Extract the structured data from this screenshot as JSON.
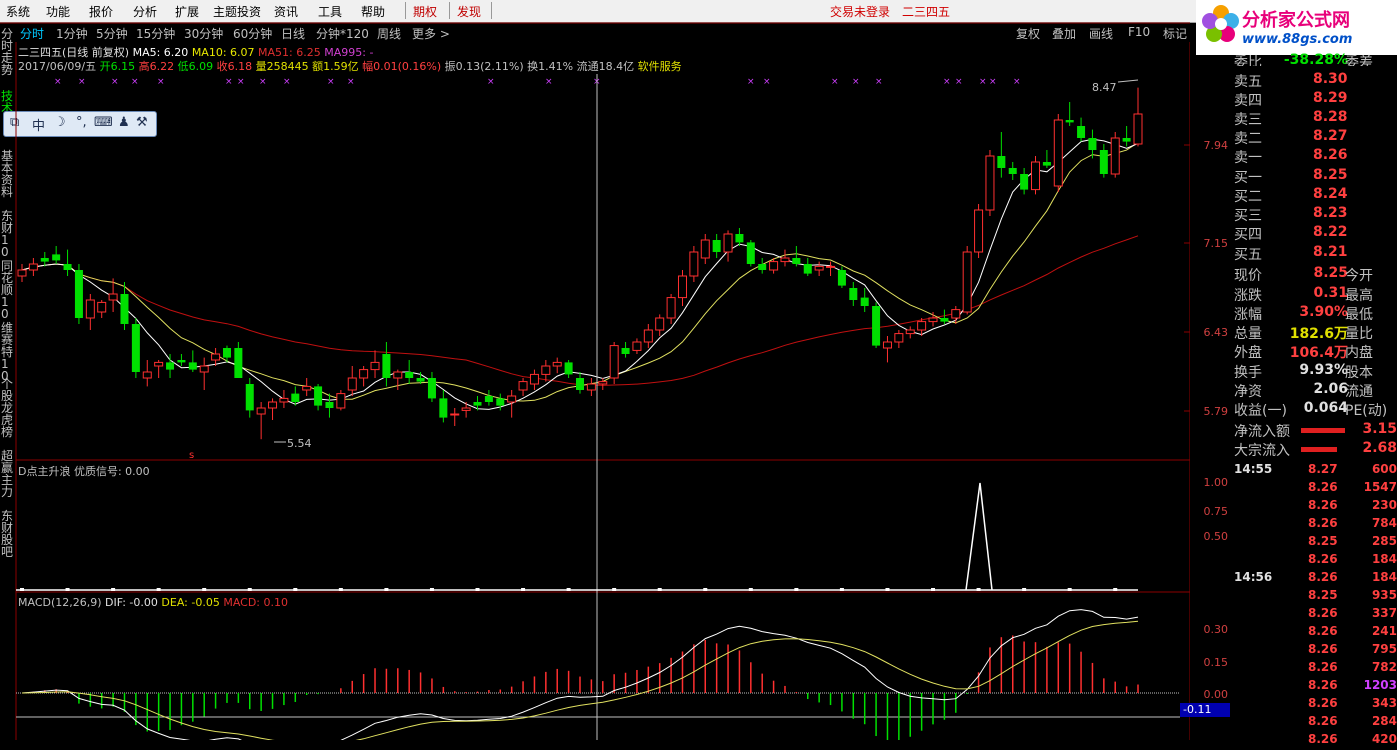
{
  "menu": {
    "items": [
      "系统",
      "功能",
      "报价",
      "分析",
      "扩展",
      "主题投资",
      "资讯",
      "工具",
      "帮助"
    ],
    "red_items": [
      "期权",
      "发现"
    ],
    "status": "交易未登录",
    "stock": "二三四五"
  },
  "logo": {
    "title": "分析家公式网",
    "url": "www.88gs.com"
  },
  "periods": [
    "分时",
    "1分钟",
    "5分钟",
    "15分钟",
    "30分钟",
    "60分钟",
    "日线",
    "分钟*120",
    "周线",
    "更多 >"
  ],
  "active_period": "分时",
  "tools_right": [
    "复权",
    "叠加",
    "画线",
    "F10",
    "标记"
  ],
  "side_tabs": [
    "分时走势",
    "技术分析",
    "基本资料",
    "东财10",
    "同花顺10",
    "维赛特10",
    "个股龙虎榜",
    "超赢主力",
    "东财股吧"
  ],
  "info": {
    "name": "二三四五(日线 前复权)",
    "ma5": "MA5: 6.20",
    "ma10": "MA10: 6.07",
    "ma51": "MA51: 6.25",
    "ma995": "MA995: -",
    "date": "2017/06/09/五",
    "open": "开6.15",
    "high": "高6.22",
    "low": "低6.09",
    "close": "收6.18",
    "vol": "量258445",
    "amount": "额1.59亿",
    "change": "幅0.01(0.16%)",
    "amplitude": "振0.13(2.11%)",
    "turnover": "换1.41%",
    "float": "流通18.4亿",
    "industry": "软件服务"
  },
  "toolbox": {
    "icons": [
      "pin-icon",
      "中",
      "moon-icon",
      "dots-icon",
      "keyboard-icon",
      "user-icon",
      "wrench-icon"
    ],
    "text": "中"
  },
  "price_axis": [
    "7.94",
    "7.15",
    "6.43",
    "5.79"
  ],
  "price_labels": {
    "high": "8.47",
    "low": "5.54"
  },
  "indicator1": {
    "title": "D点主升浪",
    "signal": "优质信号: 0.00",
    "ticks": [
      "1.00",
      "0.75",
      "0.50"
    ]
  },
  "macd": {
    "title": "MACD(12,26,9)",
    "dif": "DIF: -0.00",
    "dea": "DEA: -0.05",
    "macd": "MACD: 0.10",
    "ticks": [
      "0.30",
      "0.15",
      "0.00"
    ],
    "cursor_value": "-0.11"
  },
  "chart_data": {
    "type": "candlestick",
    "ohlc": [
      [
        6.9,
        7.0,
        6.85,
        6.95
      ],
      [
        6.95,
        7.05,
        6.9,
        7.0
      ],
      [
        7.05,
        7.1,
        6.98,
        7.02
      ],
      [
        7.08,
        7.15,
        7.0,
        7.03
      ],
      [
        7.0,
        7.12,
        6.9,
        6.95
      ],
      [
        6.95,
        7.0,
        6.5,
        6.55
      ],
      [
        6.55,
        6.75,
        6.45,
        6.7
      ],
      [
        6.6,
        6.7,
        6.55,
        6.68
      ],
      [
        6.7,
        6.88,
        6.6,
        6.75
      ],
      [
        6.75,
        6.85,
        6.45,
        6.5
      ],
      [
        6.5,
        6.55,
        6.05,
        6.1
      ],
      [
        6.05,
        6.2,
        5.98,
        6.1
      ],
      [
        6.15,
        6.2,
        6.05,
        6.18
      ],
      [
        6.18,
        6.25,
        6.05,
        6.12
      ],
      [
        6.2,
        6.25,
        6.15,
        6.18
      ],
      [
        6.18,
        6.28,
        6.1,
        6.12
      ],
      [
        6.1,
        6.22,
        5.95,
        6.15
      ],
      [
        6.2,
        6.3,
        6.15,
        6.25
      ],
      [
        6.3,
        6.32,
        6.18,
        6.22
      ],
      [
        6.3,
        6.35,
        6.05,
        6.05
      ],
      [
        6.0,
        6.05,
        5.72,
        5.78
      ],
      [
        5.75,
        5.85,
        5.54,
        5.8
      ],
      [
        5.8,
        5.88,
        5.7,
        5.85
      ],
      [
        5.85,
        5.95,
        5.8,
        5.88
      ],
      [
        5.92,
        5.98,
        5.82,
        5.85
      ],
      [
        5.95,
        6.05,
        5.9,
        5.98
      ],
      [
        5.98,
        6.0,
        5.78,
        5.82
      ],
      [
        5.85,
        5.92,
        5.72,
        5.8
      ],
      [
        5.8,
        5.95,
        5.78,
        5.92
      ],
      [
        5.95,
        6.15,
        5.9,
        6.05
      ],
      [
        6.05,
        6.15,
        5.98,
        6.12
      ],
      [
        6.12,
        6.28,
        6.05,
        6.18
      ],
      [
        6.25,
        6.35,
        5.98,
        6.05
      ],
      [
        6.05,
        6.12,
        5.95,
        6.1
      ],
      [
        6.1,
        6.2,
        6.0,
        6.05
      ],
      [
        6.05,
        6.1,
        6.0,
        6.02
      ],
      [
        6.05,
        6.1,
        5.85,
        5.88
      ],
      [
        5.88,
        5.95,
        5.68,
        5.72
      ],
      [
        5.75,
        5.8,
        5.65,
        5.75
      ],
      [
        5.78,
        5.85,
        5.72,
        5.8
      ],
      [
        5.85,
        5.9,
        5.78,
        5.82
      ],
      [
        5.9,
        5.95,
        5.82,
        5.85
      ],
      [
        5.88,
        5.92,
        5.78,
        5.82
      ],
      [
        5.85,
        5.95,
        5.72,
        5.9
      ],
      [
        5.95,
        6.05,
        5.9,
        6.02
      ],
      [
        6.0,
        6.12,
        5.95,
        6.08
      ],
      [
        6.08,
        6.2,
        6.02,
        6.15
      ],
      [
        6.15,
        6.22,
        6.09,
        6.18
      ],
      [
        6.18,
        6.2,
        6.05,
        6.08
      ],
      [
        6.05,
        6.1,
        5.92,
        5.95
      ],
      [
        5.95,
        6.05,
        5.9,
        6.0
      ],
      [
        6.0,
        6.05,
        5.95,
        6.02
      ],
      [
        6.05,
        6.35,
        6.0,
        6.32
      ],
      [
        6.3,
        6.35,
        6.22,
        6.25
      ],
      [
        6.28,
        6.38,
        6.25,
        6.35
      ],
      [
        6.35,
        6.5,
        6.3,
        6.45
      ],
      [
        6.45,
        6.58,
        6.4,
        6.55
      ],
      [
        6.55,
        6.75,
        6.5,
        6.72
      ],
      [
        6.72,
        6.95,
        6.65,
        6.9
      ],
      [
        6.9,
        7.15,
        6.85,
        7.1
      ],
      [
        7.05,
        7.25,
        7.0,
        7.2
      ],
      [
        7.2,
        7.25,
        7.05,
        7.1
      ],
      [
        7.1,
        7.28,
        7.02,
        7.25
      ],
      [
        7.25,
        7.3,
        7.15,
        7.18
      ],
      [
        7.18,
        7.2,
        6.98,
        7.0
      ],
      [
        7.0,
        7.05,
        6.92,
        6.95
      ],
      [
        6.95,
        7.05,
        6.92,
        7.02
      ],
      [
        7.02,
        7.12,
        6.98,
        7.05
      ],
      [
        7.05,
        7.15,
        6.98,
        7.0
      ],
      [
        7.0,
        7.05,
        6.9,
        6.92
      ],
      [
        6.95,
        7.02,
        6.9,
        6.98
      ],
      [
        6.98,
        7.02,
        6.9,
        6.98
      ],
      [
        6.95,
        6.98,
        6.8,
        6.82
      ],
      [
        6.8,
        6.85,
        6.65,
        6.7
      ],
      [
        6.72,
        6.8,
        6.6,
        6.65
      ],
      [
        6.65,
        6.68,
        6.3,
        6.32
      ],
      [
        6.3,
        6.4,
        6.18,
        6.35
      ],
      [
        6.35,
        6.45,
        6.3,
        6.42
      ],
      [
        6.42,
        6.48,
        6.38,
        6.45
      ],
      [
        6.45,
        6.55,
        6.4,
        6.52
      ],
      [
        6.52,
        6.6,
        6.48,
        6.55
      ],
      [
        6.55,
        6.62,
        6.5,
        6.52
      ],
      [
        6.55,
        6.65,
        6.5,
        6.62
      ],
      [
        6.6,
        7.15,
        6.58,
        7.1
      ],
      [
        7.1,
        7.5,
        7.05,
        7.45
      ],
      [
        7.45,
        7.95,
        7.4,
        7.9
      ],
      [
        7.9,
        8.1,
        7.72,
        7.8
      ],
      [
        7.8,
        7.85,
        7.7,
        7.75
      ],
      [
        7.75,
        7.8,
        7.58,
        7.62
      ],
      [
        7.62,
        7.9,
        7.58,
        7.85
      ],
      [
        7.85,
        7.95,
        7.8,
        7.82
      ],
      [
        7.65,
        8.25,
        7.6,
        8.2
      ],
      [
        8.2,
        8.35,
        8.15,
        8.18
      ],
      [
        8.15,
        8.22,
        8.02,
        8.05
      ],
      [
        8.05,
        8.12,
        7.88,
        7.95
      ],
      [
        7.95,
        8.0,
        7.72,
        7.75
      ],
      [
        7.75,
        8.1,
        7.72,
        8.05
      ],
      [
        8.05,
        8.15,
        7.98,
        8.02
      ],
      [
        8.0,
        8.47,
        7.98,
        8.25
      ]
    ],
    "ma_lines": [
      "MA5",
      "MA10",
      "MA51"
    ],
    "ylim": [
      5.45,
      8.55
    ]
  },
  "quote": {
    "weibi": {
      "label": "委比",
      "value": "-38.28%",
      "label2": "委差"
    },
    "sell": [
      {
        "label": "卖五",
        "value": "8.30"
      },
      {
        "label": "卖四",
        "value": "8.29"
      },
      {
        "label": "卖三",
        "value": "8.28"
      },
      {
        "label": "卖二",
        "value": "8.27"
      },
      {
        "label": "卖一",
        "value": "8.26"
      }
    ],
    "buy": [
      {
        "label": "买一",
        "value": "8.25"
      },
      {
        "label": "买二",
        "value": "8.24"
      },
      {
        "label": "买三",
        "value": "8.23"
      },
      {
        "label": "买四",
        "value": "8.22"
      },
      {
        "label": "买五",
        "value": "8.21"
      }
    ],
    "stats": [
      {
        "k": "现价",
        "v": "8.25",
        "k2": "今开"
      },
      {
        "k": "涨跌",
        "v": "0.31",
        "k2": "最高"
      },
      {
        "k": "涨幅",
        "v": "3.90%",
        "k2": "最低"
      },
      {
        "k": "总量",
        "v": "182.6万",
        "k2": "量比"
      },
      {
        "k": "外盘",
        "v": "106.4万",
        "k2": "内盘"
      },
      {
        "k": "换手",
        "v": "9.93%",
        "k2": "股本"
      },
      {
        "k": "净资",
        "v": "2.06",
        "k2": "流通"
      },
      {
        "k": "收益(一)",
        "v": "0.064",
        "k2": "PE(动)"
      }
    ],
    "flow": [
      {
        "k": "净流入额",
        "v": "3.15"
      },
      {
        "k": "大宗流入",
        "v": "2.68"
      }
    ]
  },
  "ticks": [
    {
      "t": "14:55",
      "p": "8.27",
      "v": "600"
    },
    {
      "t": "",
      "p": "8.26",
      "v": "1547"
    },
    {
      "t": "",
      "p": "8.26",
      "v": "230"
    },
    {
      "t": "",
      "p": "8.26",
      "v": "784"
    },
    {
      "t": "",
      "p": "8.25",
      "v": "285"
    },
    {
      "t": "",
      "p": "8.26",
      "v": "184"
    },
    {
      "t": "14:56",
      "p": "8.26",
      "v": "184"
    },
    {
      "t": "",
      "p": "8.25",
      "v": "935"
    },
    {
      "t": "",
      "p": "8.26",
      "v": "337"
    },
    {
      "t": "",
      "p": "8.26",
      "v": "241"
    },
    {
      "t": "",
      "p": "8.26",
      "v": "795"
    },
    {
      "t": "",
      "p": "8.26",
      "v": "782"
    },
    {
      "t": "",
      "p": "8.26",
      "v": "1203"
    },
    {
      "t": "",
      "p": "8.26",
      "v": "343"
    },
    {
      "t": "",
      "p": "8.26",
      "v": "284"
    },
    {
      "t": "",
      "p": "8.26",
      "v": "420"
    }
  ]
}
